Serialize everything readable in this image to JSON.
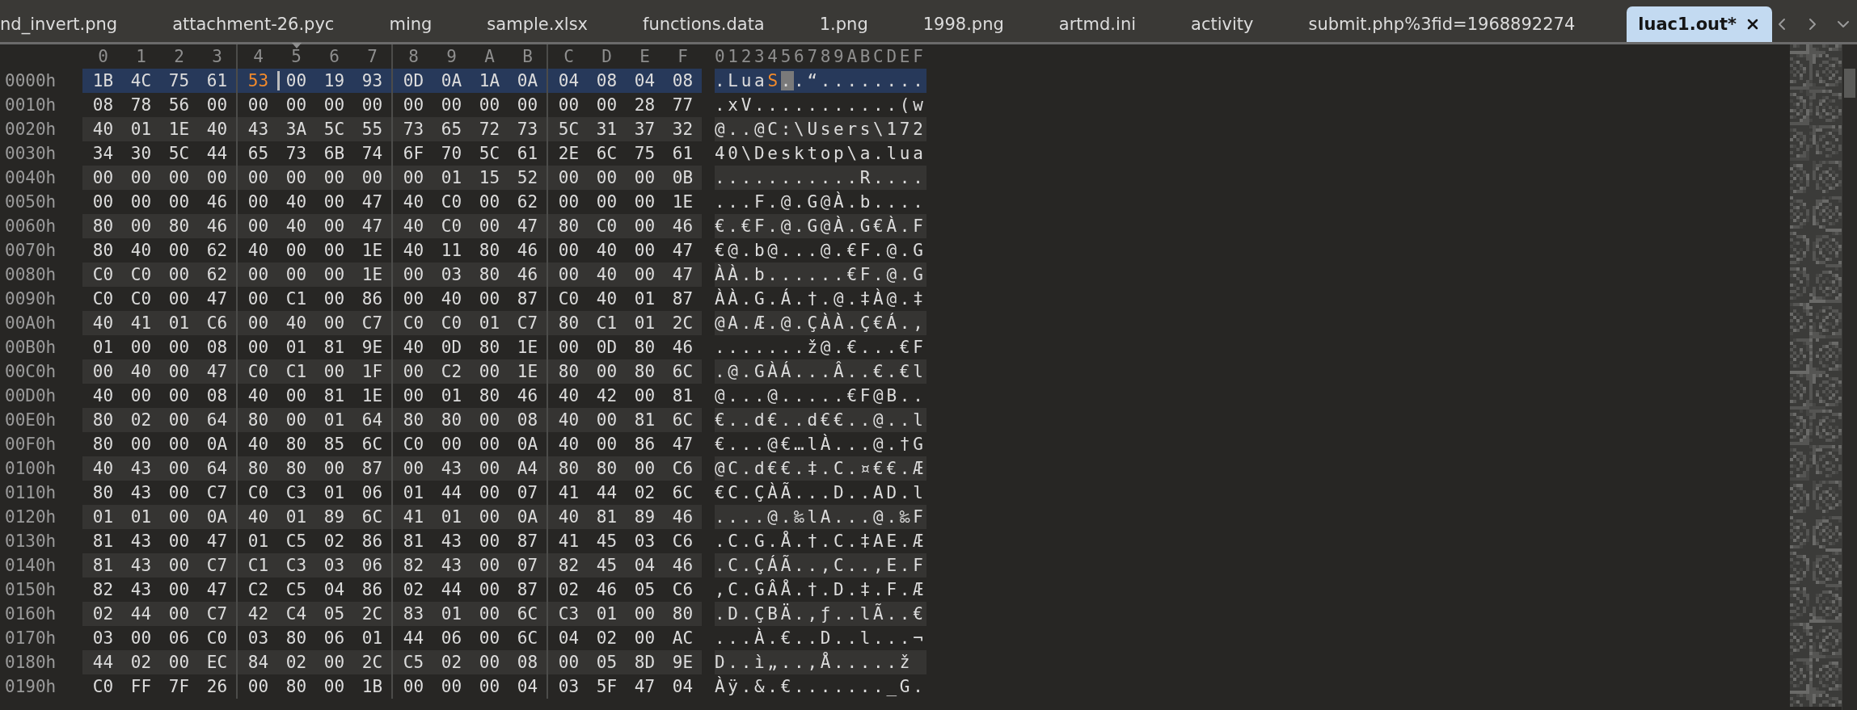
{
  "tabs": [
    {
      "label": "nd_invert.png",
      "selected": false
    },
    {
      "label": "attachment-26.pyc",
      "selected": false
    },
    {
      "label": "ming",
      "selected": false
    },
    {
      "label": "sample.xlsx",
      "selected": false
    },
    {
      "label": "functions.data",
      "selected": false
    },
    {
      "label": "1.png",
      "selected": false
    },
    {
      "label": "1998.png",
      "selected": false
    },
    {
      "label": "artmd.ini",
      "selected": false
    },
    {
      "label": "activity",
      "selected": false
    },
    {
      "label": "submit.php%3fid=1968892274",
      "selected": false
    },
    {
      "label": "luac1.out*",
      "selected": true
    }
  ],
  "header": {
    "columns": [
      "0",
      "1",
      "2",
      "3",
      "4",
      "5",
      "6",
      "7",
      "8",
      "9",
      "A",
      "B",
      "C",
      "D",
      "E",
      "F"
    ],
    "ascii": "0123456789ABCDEF"
  },
  "rows": [
    {
      "offset": "0000h",
      "selected": true,
      "bytes": [
        "1B",
        "4C",
        "75",
        "61",
        {
          "text": "53",
          "active": true,
          "caret": false
        },
        {
          "text": "00",
          "active": false,
          "caret": true
        },
        "19",
        "93",
        "0D",
        "0A",
        "1A",
        "0A",
        "04",
        "08",
        "04",
        "08"
      ],
      "ascii": [
        {
          "text": ".Lua",
          "active": false,
          "caret": false
        },
        {
          "text": "S",
          "active": true,
          "caret": false
        },
        {
          "text": ".",
          "active": false,
          "caret": true
        },
        {
          "text": ".“........",
          "active": false,
          "caret": false
        }
      ]
    },
    {
      "offset": "0010h",
      "selected": false,
      "bytes": [
        "08",
        "78",
        "56",
        "00",
        "00",
        "00",
        "00",
        "00",
        "00",
        "00",
        "00",
        "00",
        "00",
        "00",
        "28",
        "77"
      ],
      "ascii": ".xV...........(w"
    },
    {
      "offset": "0020h",
      "selected": false,
      "bytes": [
        "40",
        "01",
        "1E",
        "40",
        "43",
        "3A",
        "5C",
        "55",
        "73",
        "65",
        "72",
        "73",
        "5C",
        "31",
        "37",
        "32"
      ],
      "ascii": "@..@C:\\Users\\172"
    },
    {
      "offset": "0030h",
      "selected": false,
      "bytes": [
        "34",
        "30",
        "5C",
        "44",
        "65",
        "73",
        "6B",
        "74",
        "6F",
        "70",
        "5C",
        "61",
        "2E",
        "6C",
        "75",
        "61"
      ],
      "ascii": "40\\Desktop\\a.lua"
    },
    {
      "offset": "0040h",
      "selected": false,
      "bytes": [
        "00",
        "00",
        "00",
        "00",
        "00",
        "00",
        "00",
        "00",
        "00",
        "01",
        "15",
        "52",
        "00",
        "00",
        "00",
        "0B"
      ],
      "ascii": "...........R...."
    },
    {
      "offset": "0050h",
      "selected": false,
      "bytes": [
        "00",
        "00",
        "00",
        "46",
        "00",
        "40",
        "00",
        "47",
        "40",
        "C0",
        "00",
        "62",
        "00",
        "00",
        "00",
        "1E"
      ],
      "ascii": "...F.@.G@À.b...."
    },
    {
      "offset": "0060h",
      "selected": false,
      "bytes": [
        "80",
        "00",
        "80",
        "46",
        "00",
        "40",
        "00",
        "47",
        "40",
        "C0",
        "00",
        "47",
        "80",
        "C0",
        "00",
        "46"
      ],
      "ascii": "€.€F.@.G@À.G€À.F"
    },
    {
      "offset": "0070h",
      "selected": false,
      "bytes": [
        "80",
        "40",
        "00",
        "62",
        "40",
        "00",
        "00",
        "1E",
        "40",
        "11",
        "80",
        "46",
        "00",
        "40",
        "00",
        "47"
      ],
      "ascii": "€@.b@...@.€F.@.G"
    },
    {
      "offset": "0080h",
      "selected": false,
      "bytes": [
        "C0",
        "C0",
        "00",
        "62",
        "00",
        "00",
        "00",
        "1E",
        "00",
        "03",
        "80",
        "46",
        "00",
        "40",
        "00",
        "47"
      ],
      "ascii": "ÀÀ.b......€F.@.G"
    },
    {
      "offset": "0090h",
      "selected": false,
      "bytes": [
        "C0",
        "C0",
        "00",
        "47",
        "00",
        "C1",
        "00",
        "86",
        "00",
        "40",
        "00",
        "87",
        "C0",
        "40",
        "01",
        "87"
      ],
      "ascii": "ÀÀ.G.Á.†.@.‡À@.‡"
    },
    {
      "offset": "00A0h",
      "selected": false,
      "bytes": [
        "40",
        "41",
        "01",
        "C6",
        "00",
        "40",
        "00",
        "C7",
        "C0",
        "C0",
        "01",
        "C7",
        "80",
        "C1",
        "01",
        "2C"
      ],
      "ascii": "@A.Æ.@.ÇÀÀ.Ç€Á.,"
    },
    {
      "offset": "00B0h",
      "selected": false,
      "bytes": [
        "01",
        "00",
        "00",
        "08",
        "00",
        "01",
        "81",
        "9E",
        "40",
        "0D",
        "80",
        "1E",
        "00",
        "0D",
        "80",
        "46"
      ],
      "ascii": ".......ž@.€...€F"
    },
    {
      "offset": "00C0h",
      "selected": false,
      "bytes": [
        "00",
        "40",
        "00",
        "47",
        "C0",
        "C1",
        "00",
        "1F",
        "00",
        "C2",
        "00",
        "1E",
        "80",
        "00",
        "80",
        "6C"
      ],
      "ascii": ".@.GÀÁ...Â..€.€l"
    },
    {
      "offset": "00D0h",
      "selected": false,
      "bytes": [
        "40",
        "00",
        "00",
        "08",
        "40",
        "00",
        "81",
        "1E",
        "00",
        "01",
        "80",
        "46",
        "40",
        "42",
        "00",
        "81"
      ],
      "ascii": "@...@.....€F@B.."
    },
    {
      "offset": "00E0h",
      "selected": false,
      "bytes": [
        "80",
        "02",
        "00",
        "64",
        "80",
        "00",
        "01",
        "64",
        "80",
        "80",
        "00",
        "08",
        "40",
        "00",
        "81",
        "6C"
      ],
      "ascii": "€..d€..d€€..@..l"
    },
    {
      "offset": "00F0h",
      "selected": false,
      "bytes": [
        "80",
        "00",
        "00",
        "0A",
        "40",
        "80",
        "85",
        "6C",
        "C0",
        "00",
        "00",
        "0A",
        "40",
        "00",
        "86",
        "47"
      ],
      "ascii": "€...@€…lÀ...@.†G"
    },
    {
      "offset": "0100h",
      "selected": false,
      "bytes": [
        "40",
        "43",
        "00",
        "64",
        "80",
        "80",
        "00",
        "87",
        "00",
        "43",
        "00",
        "A4",
        "80",
        "80",
        "00",
        "C6"
      ],
      "ascii": "@C.d€€.‡.C.¤€€.Æ"
    },
    {
      "offset": "0110h",
      "selected": false,
      "bytes": [
        "80",
        "43",
        "00",
        "C7",
        "C0",
        "C3",
        "01",
        "06",
        "01",
        "44",
        "00",
        "07",
        "41",
        "44",
        "02",
        "6C"
      ],
      "ascii": "€C.ÇÀÃ...D..AD.l"
    },
    {
      "offset": "0120h",
      "selected": false,
      "bytes": [
        "01",
        "01",
        "00",
        "0A",
        "40",
        "01",
        "89",
        "6C",
        "41",
        "01",
        "00",
        "0A",
        "40",
        "81",
        "89",
        "46"
      ],
      "ascii": "....@.‰lA...@.‰F"
    },
    {
      "offset": "0130h",
      "selected": false,
      "bytes": [
        "81",
        "43",
        "00",
        "47",
        "01",
        "C5",
        "02",
        "86",
        "81",
        "43",
        "00",
        "87",
        "41",
        "45",
        "03",
        "C6"
      ],
      "ascii": ".C.G.Å.†.C.‡AE.Æ"
    },
    {
      "offset": "0140h",
      "selected": false,
      "bytes": [
        "81",
        "43",
        "00",
        "C7",
        "C1",
        "C3",
        "03",
        "06",
        "82",
        "43",
        "00",
        "07",
        "82",
        "45",
        "04",
        "46"
      ],
      "ascii": ".C.ÇÁÃ..‚C..‚E.F"
    },
    {
      "offset": "0150h",
      "selected": false,
      "bytes": [
        "82",
        "43",
        "00",
        "47",
        "C2",
        "C5",
        "04",
        "86",
        "02",
        "44",
        "00",
        "87",
        "02",
        "46",
        "05",
        "C6"
      ],
      "ascii": "‚C.GÂÅ.†.D.‡.F.Æ"
    },
    {
      "offset": "0160h",
      "selected": false,
      "bytes": [
        "02",
        "44",
        "00",
        "C7",
        "42",
        "C4",
        "05",
        "2C",
        "83",
        "01",
        "00",
        "6C",
        "C3",
        "01",
        "00",
        "80"
      ],
      "ascii": ".D.ÇBÄ.,ƒ..lÃ..€"
    },
    {
      "offset": "0170h",
      "selected": false,
      "bytes": [
        "03",
        "00",
        "06",
        "C0",
        "03",
        "80",
        "06",
        "01",
        "44",
        "06",
        "00",
        "6C",
        "04",
        "02",
        "00",
        "AC"
      ],
      "ascii": "...À.€..D..l...¬"
    },
    {
      "offset": "0180h",
      "selected": false,
      "bytes": [
        "44",
        "02",
        "00",
        "EC",
        "84",
        "02",
        "00",
        "2C",
        "C5",
        "02",
        "00",
        "08",
        "00",
        "05",
        "8D",
        "9E"
      ],
      "ascii": "D..ì„..,Å.....ž"
    },
    {
      "offset": "0190h",
      "selected": false,
      "bytes": [
        "C0",
        "FF",
        "7F",
        "26",
        "00",
        "80",
        "00",
        "1B",
        "00",
        "00",
        "00",
        "04",
        "03",
        "5F",
        "47",
        "04"
      ],
      "ascii": "Àÿ.&.€......._G."
    }
  ]
}
